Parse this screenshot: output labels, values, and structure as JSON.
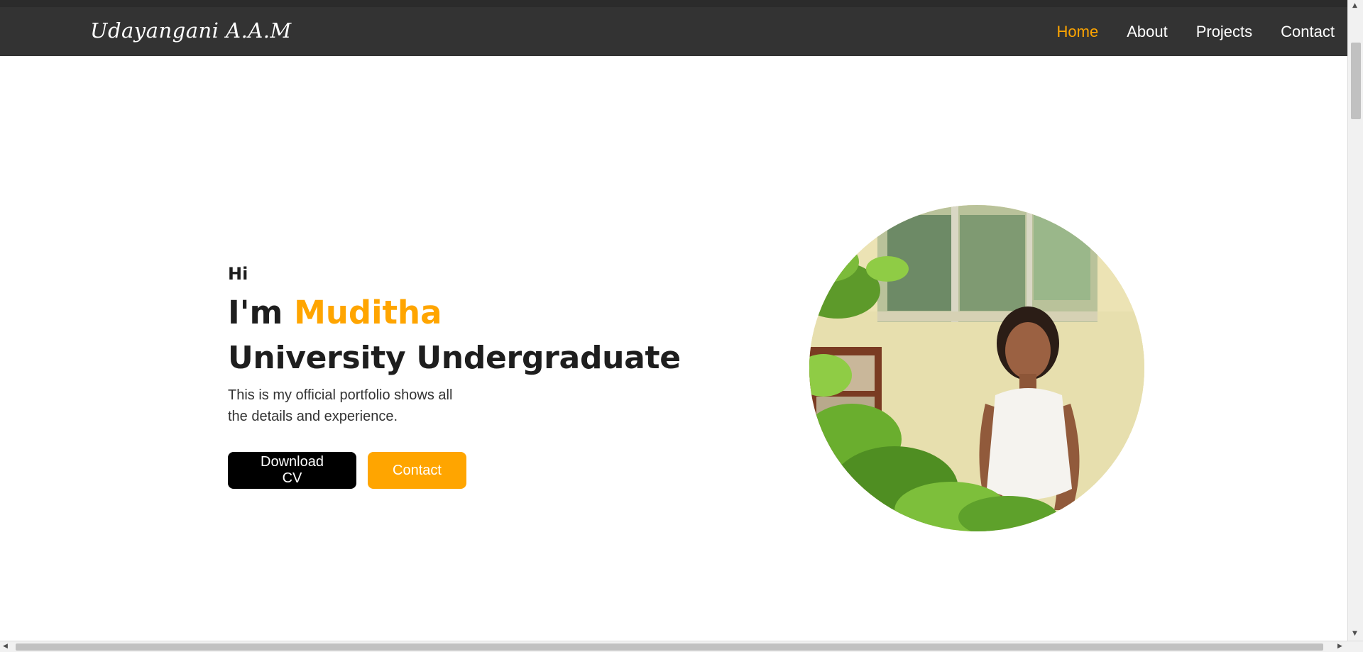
{
  "header": {
    "brand": "Udayangani A.A.M",
    "nav": [
      {
        "label": "Home",
        "active": true
      },
      {
        "label": "About",
        "active": false
      },
      {
        "label": "Projects",
        "active": false
      },
      {
        "label": "Contact",
        "active": false
      }
    ]
  },
  "hero": {
    "greeting": "Hi",
    "intro_prefix": "I'm",
    "name": "Muditha",
    "role": "University Undergraduate",
    "description": "This is my official portfolio shows all the details and experience.",
    "buttons": {
      "download": "Download CV",
      "contact": "Contact"
    }
  },
  "colors": {
    "accent": "#ffa500",
    "navbar_bg": "#333333",
    "text_dark": "#1e1e1e"
  }
}
